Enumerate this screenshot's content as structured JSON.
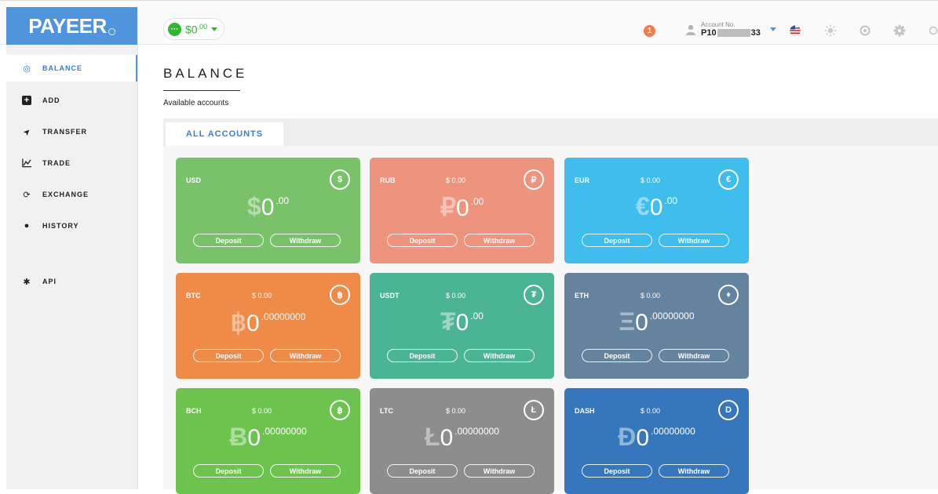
{
  "brand": {
    "logo": "PAYEER"
  },
  "header": {
    "balance": {
      "main": "$0",
      "sup": ".00"
    },
    "notifications": "1",
    "account": {
      "label": "Account No.",
      "prefix": "P10",
      "suffix": "33"
    }
  },
  "sidebar": {
    "items": [
      {
        "label": "BALANCE",
        "icon": "gauge-icon",
        "glyph": "◎"
      },
      {
        "label": "ADD",
        "icon": "plus-square-icon",
        "glyph": "+"
      },
      {
        "label": "TRANSFER",
        "icon": "paper-plane-icon",
        "glyph": "➤"
      },
      {
        "label": "TRADE",
        "icon": "chart-line-icon",
        "glyph": "⩘"
      },
      {
        "label": "EXCHANGE",
        "icon": "exchange-icon",
        "glyph": "⟳"
      },
      {
        "label": "HISTORY",
        "icon": "clock-icon",
        "glyph": "●"
      },
      {
        "label": "API",
        "icon": "gears-icon",
        "glyph": "✱"
      }
    ]
  },
  "main": {
    "title": "BALANCE",
    "subtitle": "Available accounts",
    "tab": "ALL ACCOUNTS"
  },
  "buttons": {
    "deposit": "Deposit",
    "withdraw": "Withdraw"
  },
  "cards": [
    {
      "code": "USD",
      "usd": "",
      "symbol": "$",
      "int": "0",
      "dec": ".00",
      "icon": "$",
      "color": "#79c26a"
    },
    {
      "code": "RUB",
      "usd": "$ 0.00",
      "symbol": "₽",
      "int": "0",
      "dec": ".00",
      "icon": "₽",
      "color": "#ee937e"
    },
    {
      "code": "EUR",
      "usd": "$ 0.00",
      "symbol": "€",
      "int": "0",
      "dec": ".00",
      "icon": "€",
      "color": "#3fbdec"
    },
    {
      "code": "BTC",
      "usd": "$ 0.00",
      "symbol": "฿",
      "int": "0",
      "dec": ".00000000",
      "icon": "฿",
      "color": "#ef8a48"
    },
    {
      "code": "USDT",
      "usd": "$ 0.00",
      "symbol": "₮",
      "int": "0",
      "dec": ".00",
      "icon": "₮",
      "color": "#4bb494"
    },
    {
      "code": "ETH",
      "usd": "$ 0.00",
      "symbol": "Ξ",
      "int": "0",
      "dec": ".00000000",
      "icon": "♦",
      "color": "#63839f"
    },
    {
      "code": "BCH",
      "usd": "$ 0.00",
      "symbol": "Ƀ",
      "int": "0",
      "dec": ".00000000",
      "icon": "฿",
      "color": "#6cc44f"
    },
    {
      "code": "LTC",
      "usd": "$ 0.00",
      "symbol": "Ł",
      "int": "0",
      "dec": ".00000000",
      "icon": "Ł",
      "color": "#8d8d8d"
    },
    {
      "code": "DASH",
      "usd": "$ 0.00",
      "symbol": "Đ",
      "int": "0",
      "dec": ".00000000",
      "icon": "D",
      "color": "#3576bd"
    }
  ]
}
